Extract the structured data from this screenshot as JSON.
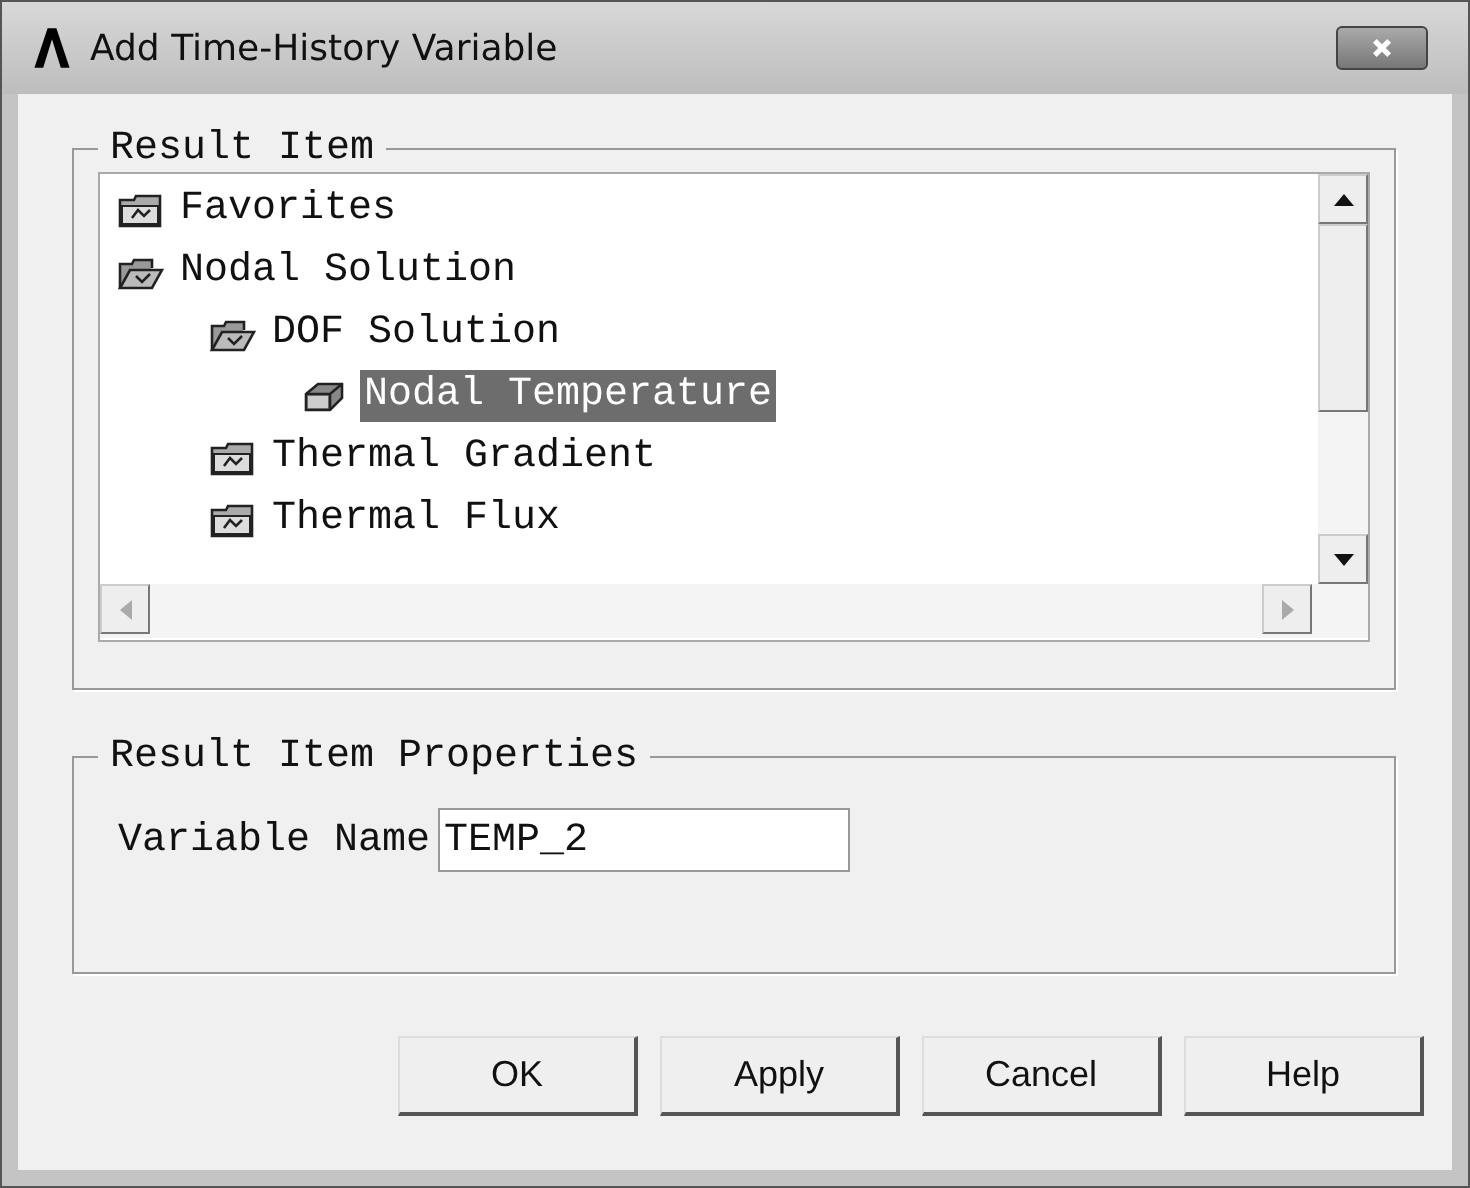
{
  "window": {
    "title": "Add Time-History Variable"
  },
  "result_item": {
    "legend": "Result Item",
    "tree": [
      {
        "label": "Favorites",
        "kind": "folder",
        "expanded": false,
        "selected": false
      },
      {
        "label": "Nodal Solution",
        "kind": "folder",
        "expanded": true,
        "selected": false,
        "children": [
          {
            "label": "DOF Solution",
            "kind": "folder",
            "expanded": true,
            "selected": false,
            "children": [
              {
                "label": "Nodal Temperature",
                "kind": "item",
                "selected": true
              }
            ]
          },
          {
            "label": "Thermal Gradient",
            "kind": "folder",
            "expanded": false,
            "selected": false
          },
          {
            "label": "Thermal Flux",
            "kind": "folder",
            "expanded": false,
            "selected": false
          }
        ]
      }
    ]
  },
  "properties": {
    "legend": "Result Item Properties",
    "field_label": "Variable Name",
    "field_value": "TEMP_2"
  },
  "buttons": [
    "OK",
    "Apply",
    "Cancel",
    "Help"
  ]
}
